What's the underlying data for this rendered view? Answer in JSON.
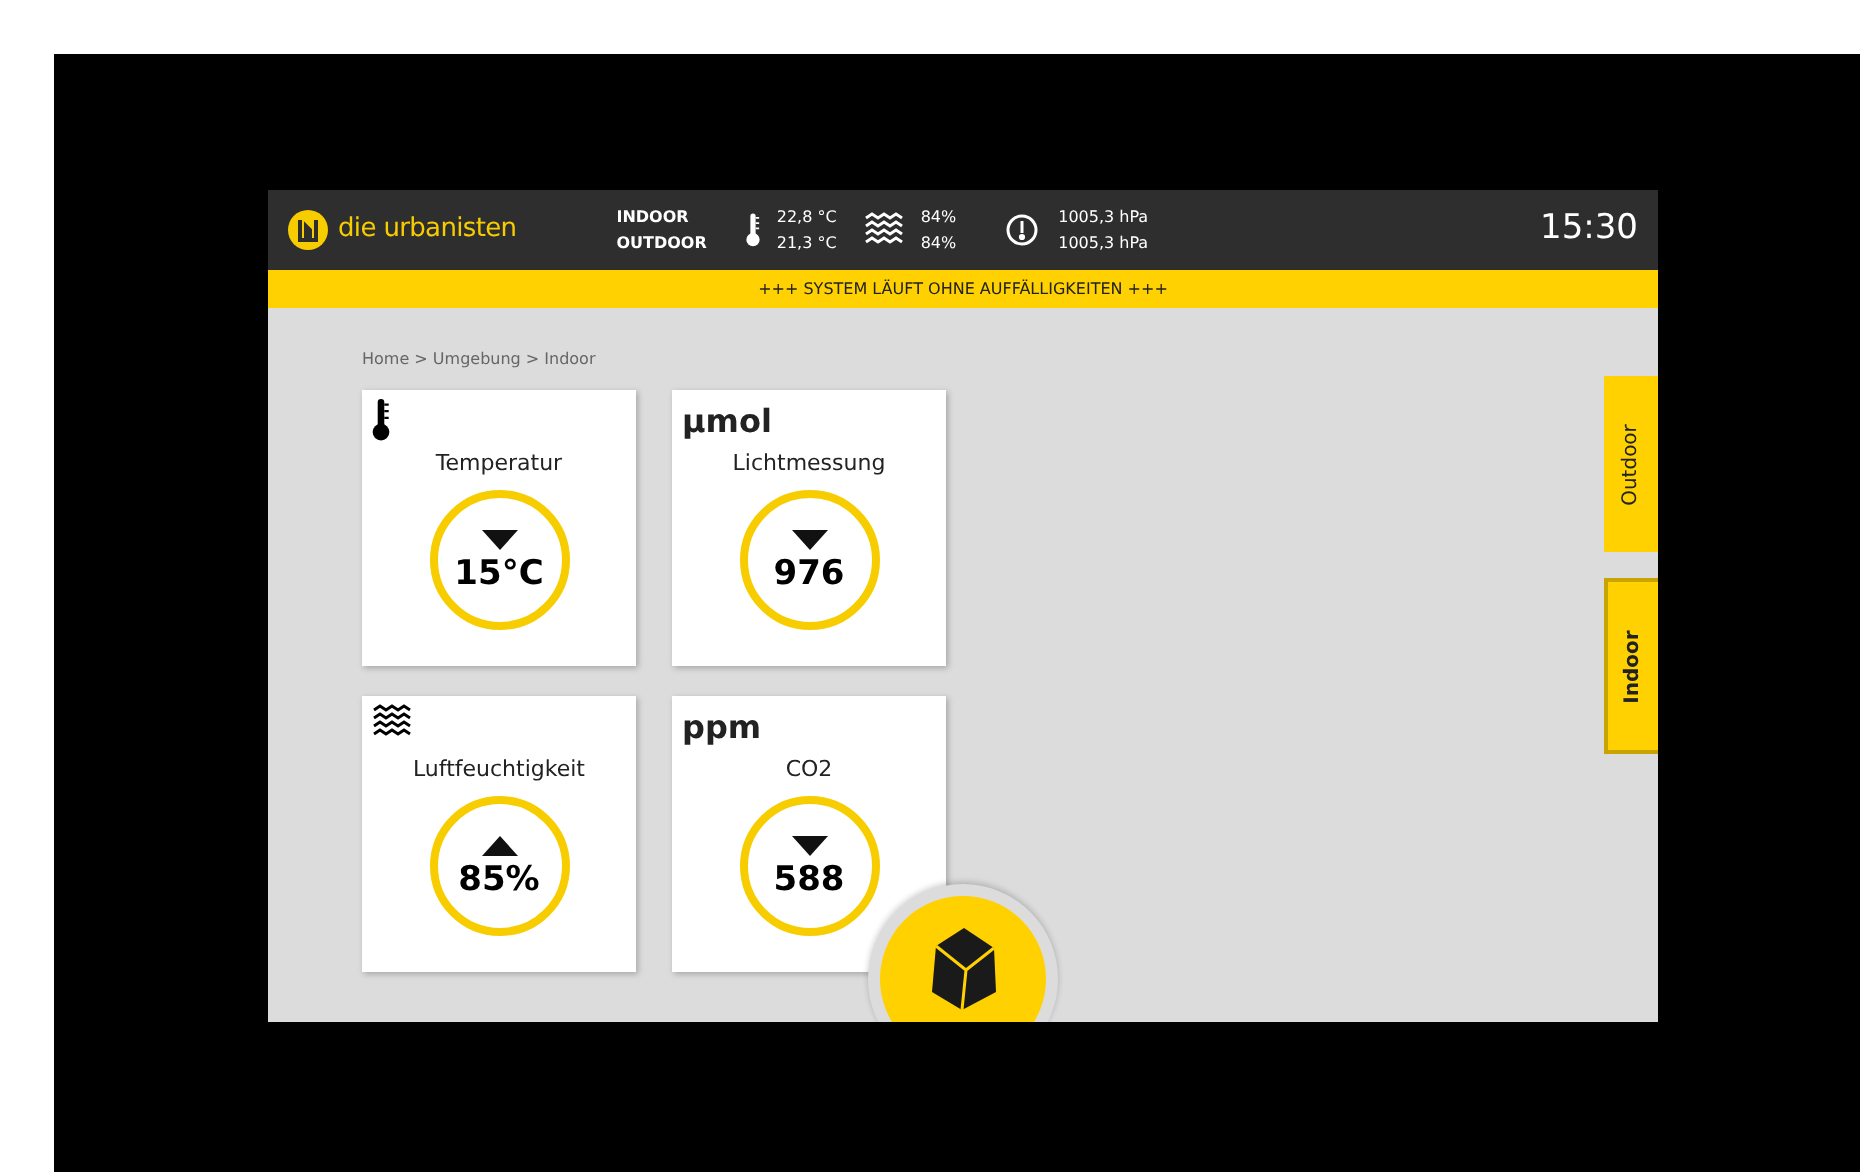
{
  "header": {
    "brand": "die urbanisten",
    "locations": [
      "INDOOR",
      "OUTDOOR"
    ],
    "temperature": [
      "22,8 °C",
      "21,3 °C"
    ],
    "humidity": [
      "84%",
      "84%"
    ],
    "pressure": [
      "1005,3 hPa",
      "1005,3 hPa"
    ],
    "time": "15:30"
  },
  "status_banner": "+++ SYSTEM LÄUFT OHNE AUFFÄLLIGKEITEN +++",
  "breadcrumb": "Home > Umgebung > Indoor",
  "cards": [
    {
      "kind": "temperature",
      "title": "Temperatur",
      "value": "15°C",
      "rising": false
    },
    {
      "kind": "unit",
      "unit": "µmol",
      "title": "Lichtmessung",
      "value": "976",
      "rising": false
    },
    {
      "kind": "humidity",
      "title": "Luftfeuchtigkeit",
      "value": "85%",
      "rising": true
    },
    {
      "kind": "unit",
      "unit": "ppm",
      "title": "CO2",
      "value": "588",
      "rising": false
    }
  ],
  "side_tabs": [
    {
      "label": "Outdoor",
      "selected": false
    },
    {
      "label": "Indoor",
      "selected": true
    }
  ]
}
